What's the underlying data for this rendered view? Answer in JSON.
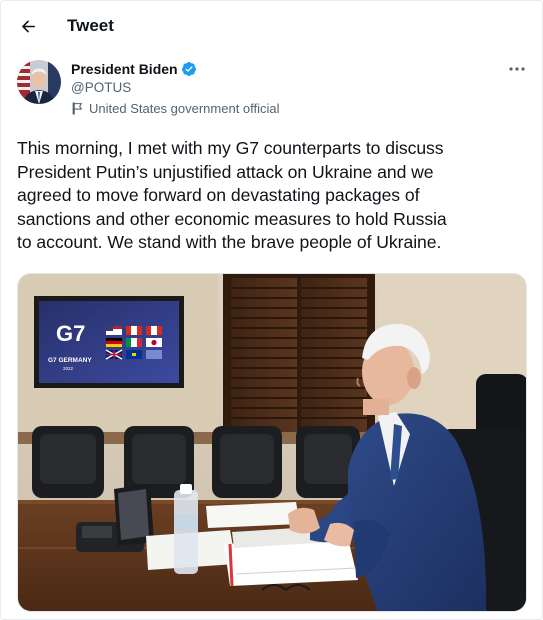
{
  "header": {
    "title": "Tweet"
  },
  "author": {
    "name": "President Biden",
    "handle": "@POTUS",
    "affiliation": "United States government official"
  },
  "tweet": {
    "text": "This morning, I met with my G7 counterparts to discuss\nPresident Putin’s unjustified attack on Ukraine and we\nagreed to move forward on devastating packages of\nsanctions and other economic measures to hold Russia\nto account. We stand with the brave people of Ukraine."
  },
  "media": {
    "screen_logo": "G7",
    "screen_caption": "G7 GERMANY",
    "screen_year": "2022"
  },
  "colors": {
    "verified": "#1d9bf0",
    "text_primary": "#0f1419",
    "text_secondary": "#536471",
    "border": "#e6ecf0"
  },
  "icons": {
    "back": "arrow-left-icon",
    "verified": "verified-badge-icon",
    "affiliation": "flag-icon",
    "more": "more-horizontal-icon"
  }
}
